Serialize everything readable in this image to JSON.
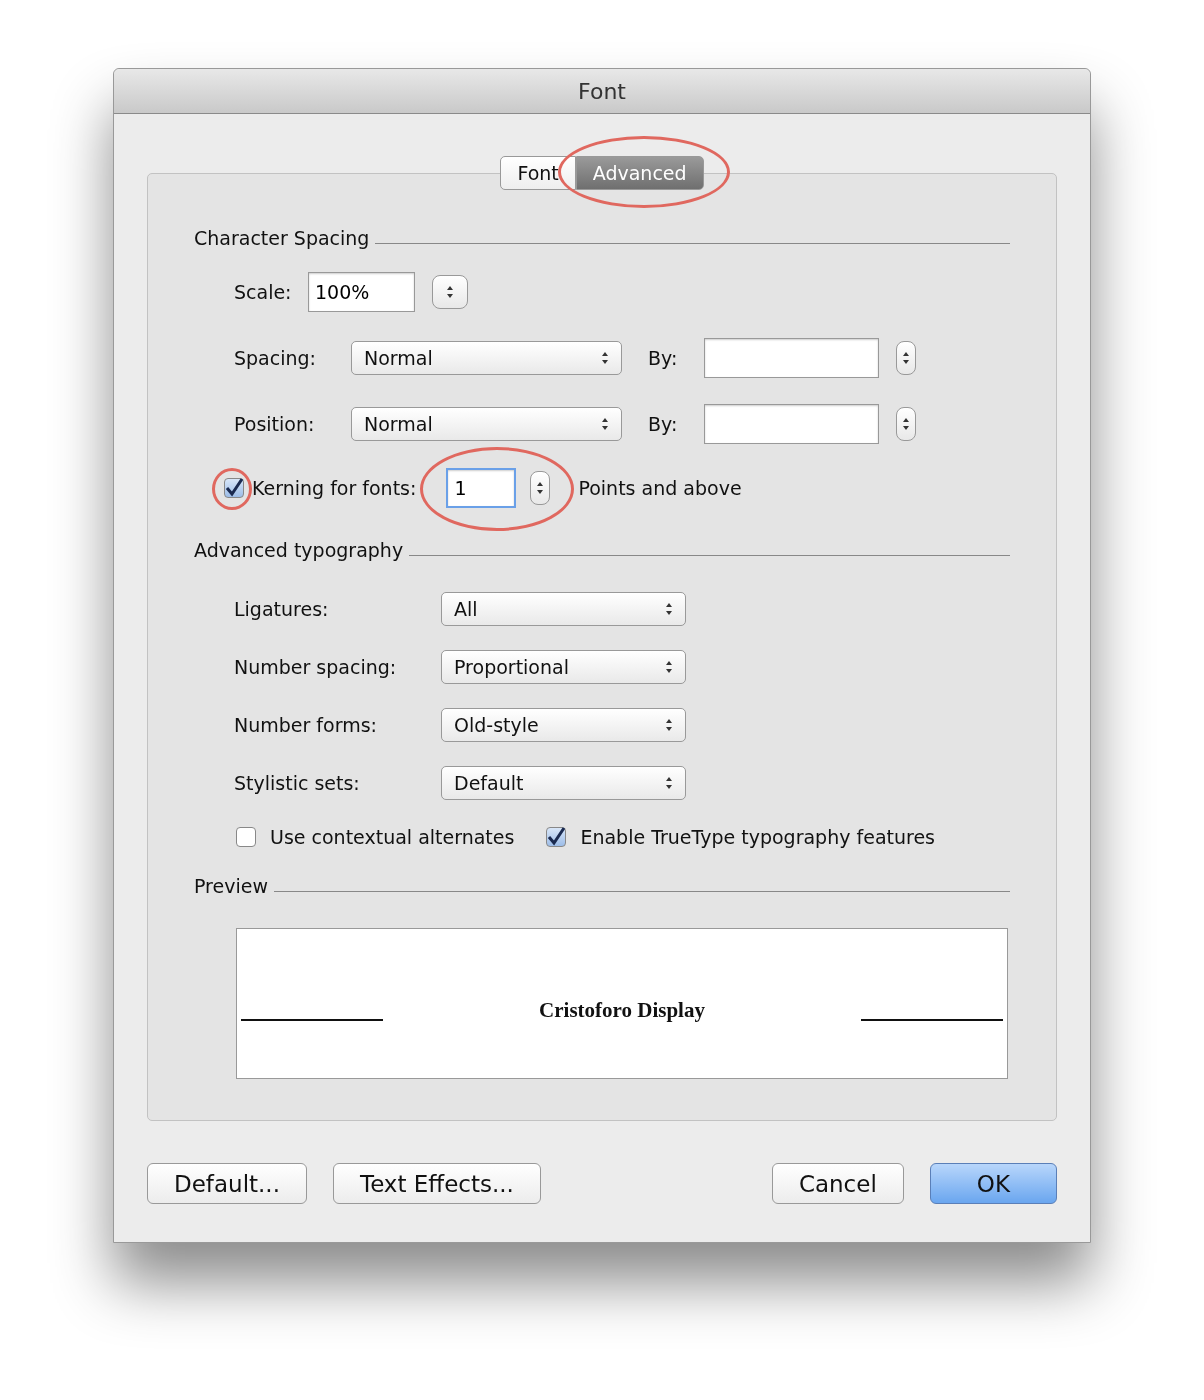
{
  "window": {
    "title": "Font"
  },
  "tabs": [
    {
      "label": "Font",
      "selected": false,
      "annotated": false
    },
    {
      "label": "Advanced",
      "selected": true,
      "annotated": true
    }
  ],
  "character_spacing": {
    "heading": "Character Spacing",
    "scale": {
      "label": "Scale:",
      "value": "100%"
    },
    "spacing": {
      "label": "Spacing:",
      "value": "Normal",
      "by_label": "By:"
    },
    "position": {
      "label": "Position:",
      "value": "Normal",
      "by_label": "By:"
    },
    "kerning": {
      "label": "Kerning for fonts:",
      "checked": true,
      "checkbox_annotated": true,
      "value": "1",
      "field_annotated": true,
      "suffix": "Points and above"
    }
  },
  "advanced_typography": {
    "heading": "Advanced typography",
    "dropdowns": [
      {
        "label": "Ligatures:",
        "value": "All"
      },
      {
        "label": "Number spacing:",
        "value": "Proportional"
      },
      {
        "label": "Number forms:",
        "value": "Old-style"
      },
      {
        "label": "Stylistic sets:",
        "value": "Default"
      }
    ],
    "checkboxes": [
      {
        "label": "Use contextual alternates",
        "checked": false
      },
      {
        "label": "Enable TrueType typography features",
        "checked": true
      }
    ]
  },
  "preview": {
    "heading": "Preview",
    "sample": "Cristoforo Display"
  },
  "buttons_left": [
    {
      "label": "Default...",
      "default": false
    },
    {
      "label": "Text Effects...",
      "default": false
    }
  ],
  "buttons_right": [
    {
      "label": "Cancel",
      "default": false
    },
    {
      "label": "OK",
      "default": true
    }
  ]
}
